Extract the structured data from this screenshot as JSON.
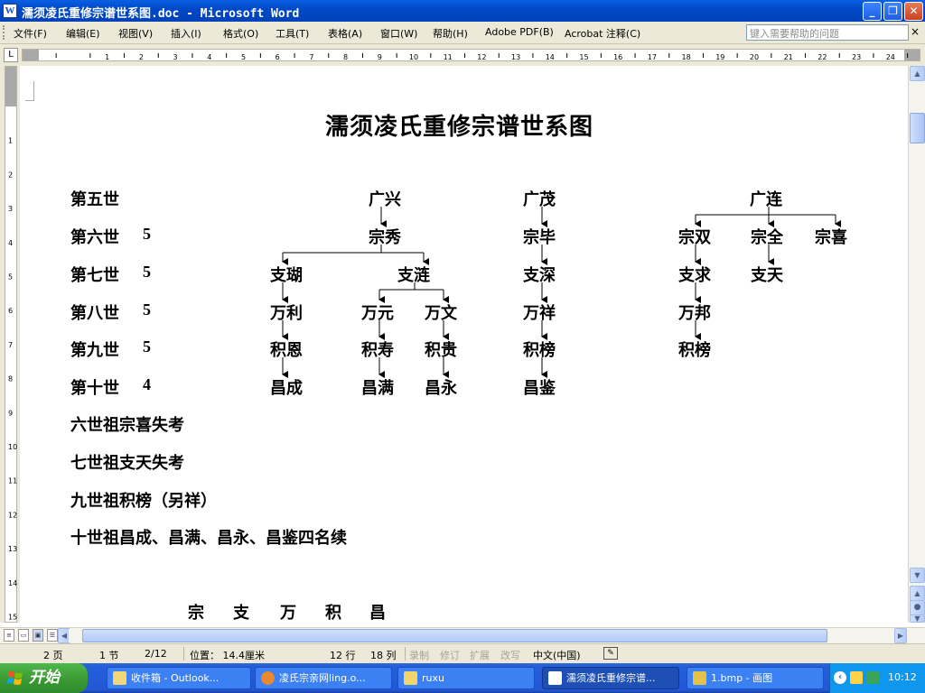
{
  "window": {
    "title": "濡须凌氏重修宗谱世系图.doc - Microsoft Word",
    "app_icon": "W"
  },
  "menu": {
    "items": [
      "文件(F)",
      "编辑(E)",
      "视图(V)",
      "插入(I)",
      "格式(O)",
      "工具(T)",
      "表格(A)",
      "窗口(W)",
      "帮助(H)",
      "Adobe PDF(B)",
      "Acrobat 注释(C)"
    ],
    "help_placeholder": "键入需要帮助的问题",
    "close_doc": "×"
  },
  "document": {
    "title": "濡须凌氏重修宗谱世系图",
    "generations": [
      {
        "label": "第五世",
        "count": ""
      },
      {
        "label": "第六世",
        "count": "5"
      },
      {
        "label": "第七世",
        "count": "5"
      },
      {
        "label": "第八世",
        "count": "5"
      },
      {
        "label": "第九世",
        "count": "5"
      },
      {
        "label": "第十世",
        "count": "4"
      }
    ],
    "tree": {
      "gen5": [
        "广兴",
        "广茂",
        "广连"
      ],
      "gen6": [
        "宗秀",
        "宗毕",
        "宗双",
        "宗全",
        "宗喜"
      ],
      "gen7": [
        "支瑚",
        "支涟",
        "支深",
        "支求",
        "支天"
      ],
      "gen8": [
        "万利",
        "万元",
        "万文",
        "万祥",
        "万邦"
      ],
      "gen9": [
        "积恩",
        "积寿",
        "积贵",
        "积榜",
        "积榜"
      ],
      "gen10": [
        "昌成",
        "昌满",
        "昌永",
        "昌鉴"
      ]
    },
    "notes": [
      "六世祖宗喜失考",
      "七世祖支天失考",
      "九世祖积榜（另祥）",
      "十世祖昌成、昌满、昌永、昌鉴四名续"
    ],
    "footer_row": [
      "宗",
      "支",
      "万",
      "积",
      "昌"
    ]
  },
  "statusbar": {
    "page": "2 页",
    "section": "1 节",
    "page_of": "2/12",
    "position": "位置： 14.4厘米",
    "line": "12 行",
    "column": "18 列",
    "rec": "录制",
    "trk": "修订",
    "ext": "扩展",
    "ovr": "改写",
    "language": "中文(中国)"
  },
  "taskbar": {
    "start_label": "开始",
    "buttons": [
      {
        "label": "收件箱 - Outlook..."
      },
      {
        "label": "凌氏宗亲网ling.o..."
      },
      {
        "label": "ruxu"
      },
      {
        "label": "濡须凌氏重修宗谱..."
      },
      {
        "label": "1.bmp - 画图"
      }
    ],
    "clock": "10:12"
  }
}
